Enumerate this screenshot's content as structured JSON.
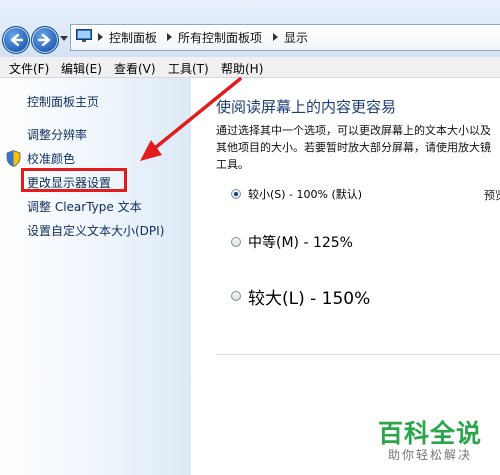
{
  "address_bar": {
    "breadcrumbs": [
      "控制面板",
      "所有控制面板项",
      "显示"
    ]
  },
  "menu": {
    "items": [
      "文件(F)",
      "编辑(E)",
      "查看(V)",
      "工具(T)",
      "帮助(H)"
    ]
  },
  "sidebar": {
    "home": "控制面板主页",
    "links": [
      "调整分辨率",
      "校准颜色",
      "更改显示器设置",
      "调整 ClearType 文本",
      "设置自定义文本大小(DPI)"
    ]
  },
  "main": {
    "title": "使阅读屏幕上的内容更容易",
    "description": "通过选择其中一个选项，可以更改屏幕上的文本大小以及其他项目的大小。若要暂时放大部分屏幕，请使用放大镜工具。",
    "options": [
      {
        "label": "较小(S) - 100% (默认)",
        "selected": true
      },
      {
        "label": "中等(M) - 125%",
        "selected": false
      },
      {
        "label": "较大(L) - 150%",
        "selected": false
      }
    ],
    "preview_label": "预览"
  },
  "watermark": {
    "title": "百科全说",
    "subtitle": "助你轻松解决"
  },
  "colors": {
    "highlight": "#e21b1b",
    "link": "#0f2e5c",
    "title": "#1d3d7a",
    "watermark": "#2aa64a"
  }
}
